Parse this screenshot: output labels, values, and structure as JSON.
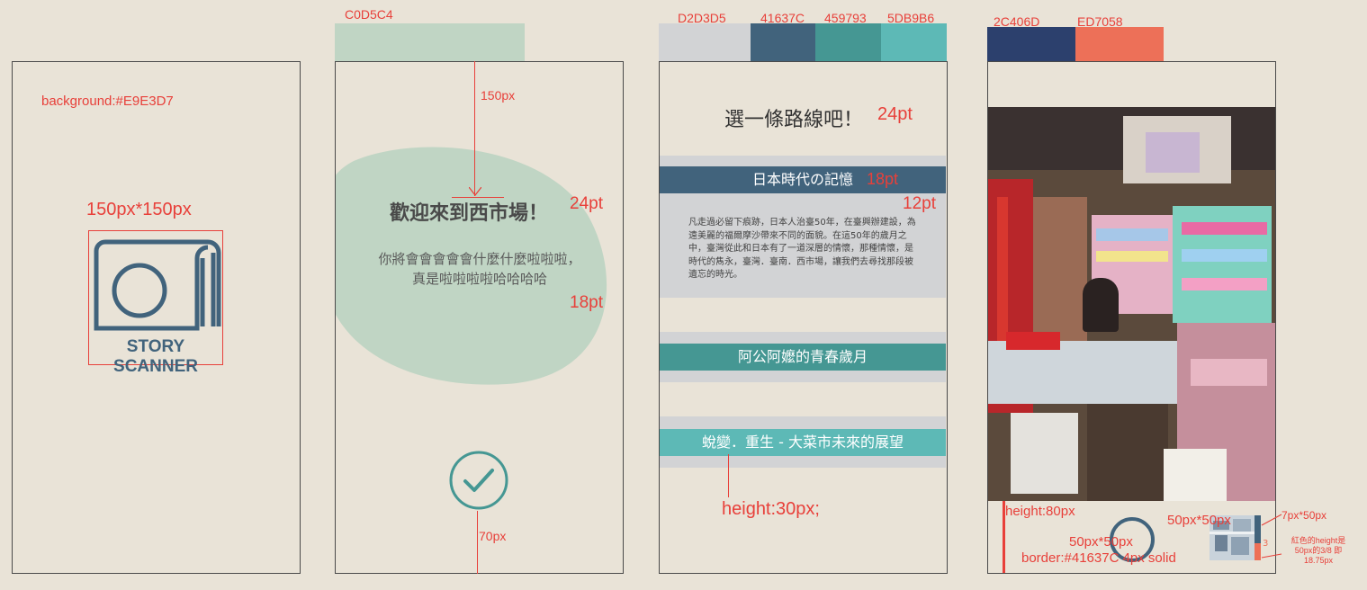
{
  "colors": {
    "background": "#E9E3D7",
    "green": "#C0D5C4",
    "gray": "#D2D3D5",
    "navy_slate": "#41637C",
    "teal": "#459793",
    "aqua": "#5DB9B6",
    "navy": "#2C406D",
    "coral": "#ED7058",
    "annotation": "#E8403A"
  },
  "screen1": {
    "bg_label": "background:#E9E3D7",
    "logo_size_label": "150px*150px",
    "logo_text": "STORY SCANNER"
  },
  "screen2": {
    "swatch_label": "C0D5C4",
    "top_margin_label": "150px",
    "title": "歡迎來到西市場！",
    "title_size_label": "24pt",
    "body": "你將會會會會會什麼什麼啦啦啦，真是啦啦啦啦哈哈哈哈",
    "body_size_label": "18pt",
    "bottom_margin_label": "70px"
  },
  "screen3": {
    "swatches": [
      "D2D3D5",
      "41637C",
      "459793",
      "5DB9B6"
    ],
    "title": "選一條路線吧！",
    "title_size_label": "24pt",
    "route1": "日本時代の記憶",
    "route1_size_label": "18pt",
    "desc_size_label": "12pt",
    "desc": "凡走過必留下痕跡，日本人治臺50年，在臺興辦建設，為遠美麗的福爾摩沙帶來不同的面貌。在這50年的歲月之中，臺灣從此和日本有了一道深層的情懷，那種情懷，是時代的雋永，臺灣．臺南．西市場，讓我們去尋找那段被遺忘的時光。",
    "route2": "阿公阿嬤的青春歲月",
    "route3": "蛻變．重生 - 大菜市未來的展望",
    "height_label": "height:30px;"
  },
  "screen4": {
    "swatches": [
      "2C406D",
      "ED7058"
    ],
    "height_label": "height:80px",
    "circle_size_label": "50px*50px",
    "circle_border_label": "border:#41637C 4px solid",
    "map_size_label": "50px*50px",
    "map_badge": "3",
    "progress_size_label": "7px*50px",
    "progress_note": "紅色的height是50px的3/8 即18.75px",
    "progress_fraction": 0.375
  }
}
